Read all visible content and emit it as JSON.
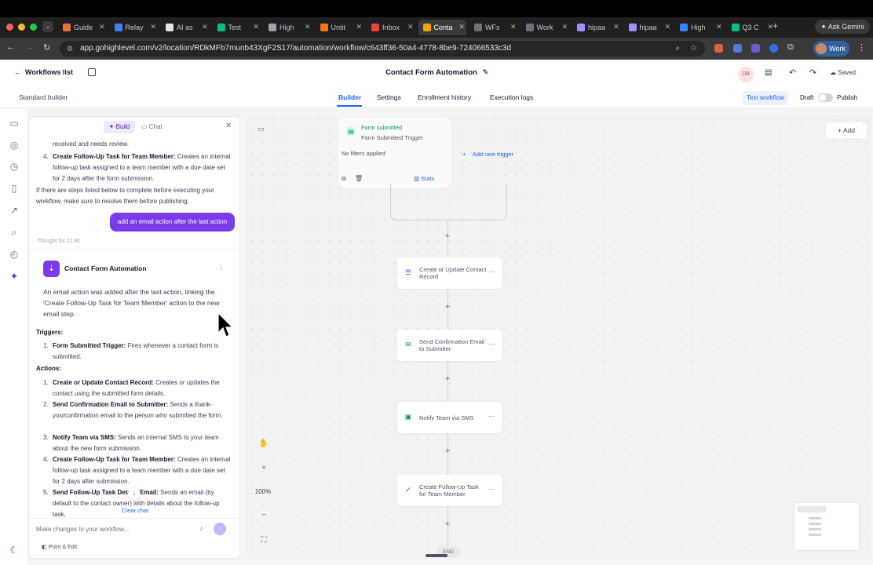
{
  "browser": {
    "tabs": [
      "Guide",
      "Relay",
      "AI as",
      "Test",
      "High",
      "Untit",
      "Inbox",
      "Conta",
      "WFs",
      "Work",
      "hipaa",
      "hipaa",
      "High",
      "Q3 C"
    ],
    "ask_gemini": "Ask Gemini",
    "url": "app.gohighlevel.com/v2/location/RDkMFb7munb43XgF2S17/automation/workflow/c643ff36-50a4-4778-8be9-724066533c3d",
    "profile": "Work"
  },
  "header": {
    "back": "Workflows list",
    "title": "Contact Form Automation",
    "avatar": "DB",
    "saved": "Saved",
    "builder_mode": "Standard builder",
    "tabs": [
      "Builder",
      "Settings",
      "Enrollment history",
      "Execution logs"
    ],
    "test_workflow": "Test workflow",
    "draft": "Draft",
    "publish": "Publish"
  },
  "chat": {
    "tab_build": "Build",
    "tab_chat": "Chat",
    "prev_line": "received and needs review.",
    "prev_item4_num": "4.",
    "prev_item4_title": "Create Follow-Up Task for Team Member:",
    "prev_item4_text": " Creates an internal follow-up task assigned to a team member with a due date set for 2 days after the form submission.",
    "prev_note": "If there are steps listed below to complete before executing your workflow, make sure to resolve them before publishing.",
    "user_msg": "add an email action after the last action",
    "thought": "Thought for 21.8s",
    "card_title": "Contact Form Automation",
    "summary": "An email action was added after the last action, linking the 'Create Follow-Up Task for Team Member' action to the new email step.",
    "triggers_label": "Triggers:",
    "trigger_num": "1.",
    "trigger_title": "Form Submitted Trigger:",
    "trigger_text": " Fires whenever a contact form is submitted.",
    "actions_label": "Actions:",
    "actions": [
      {
        "num": "1.",
        "title": "Create or Update Contact Record:",
        "text": " Creates or updates the contact using the submitted form details."
      },
      {
        "num": "2.",
        "title": "Send Confirmation Email to Submitter:",
        "text": " Sends a thank-you/confirmation email to the person who submitted the form."
      },
      {
        "num": "3.",
        "title": "Notify Team via SMS:",
        "text": " Sends an internal SMS to your team about the new form submission."
      },
      {
        "num": "4.",
        "title": "Create Follow-Up Task for Team Member:",
        "text": " Creates an internal follow-up task assigned to a team member with a due date set for 2 days after submission."
      },
      {
        "num": "5.",
        "title": "Send Follow-Up Task Details Email:",
        "text": " Sends an email (by default to the contact owner) with details about the follow-up task,"
      }
    ],
    "clear_chat": "Clear chat",
    "input_placeholder": "Make changes to your workflow...",
    "point_edit": "Point & Edit"
  },
  "canvas": {
    "add": "Add",
    "trigger_label": "Form submitted",
    "trigger_sub": "Form Submitted Trigger",
    "filters": "No filters applied",
    "stats": "Stats",
    "add_trigger": "Add new trigger",
    "nodes": [
      {
        "line1": "Create or Update Contact",
        "line2": "Record",
        "color": "#4f46e5",
        "icon": "☰"
      },
      {
        "line1": "Send Confirmation Email",
        "line2": "to Submitter",
        "color": "#059669",
        "icon": "✉"
      },
      {
        "line1": "Notify Team via SMS",
        "line2": "",
        "color": "#059669",
        "icon": "▣"
      },
      {
        "line1": "Create Follow-Up Task",
        "line2": "for Team Member",
        "color": "#4f46e5",
        "icon": "✓"
      }
    ],
    "end": "END",
    "zoom": "100%"
  }
}
